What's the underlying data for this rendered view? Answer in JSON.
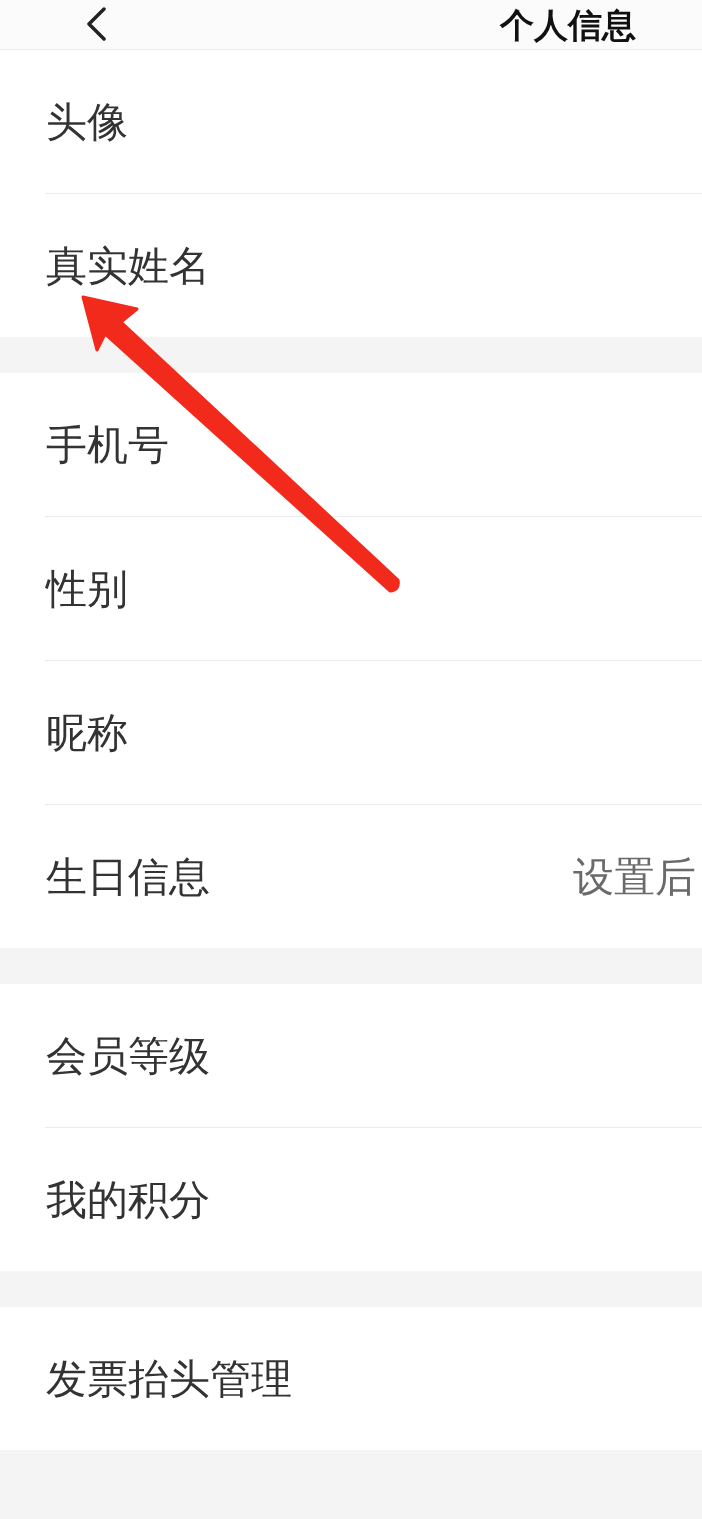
{
  "header": {
    "title": "个人信息"
  },
  "sections": [
    {
      "items": [
        {
          "label": "头像"
        },
        {
          "label": "真实姓名"
        }
      ]
    },
    {
      "items": [
        {
          "label": "手机号"
        },
        {
          "label": "性别"
        },
        {
          "label": "昵称"
        },
        {
          "label": "生日信息",
          "value": "设置后"
        }
      ]
    },
    {
      "items": [
        {
          "label": "会员等级"
        },
        {
          "label": "我的积分"
        }
      ]
    },
    {
      "items": [
        {
          "label": "发票抬头管理"
        }
      ]
    }
  ]
}
